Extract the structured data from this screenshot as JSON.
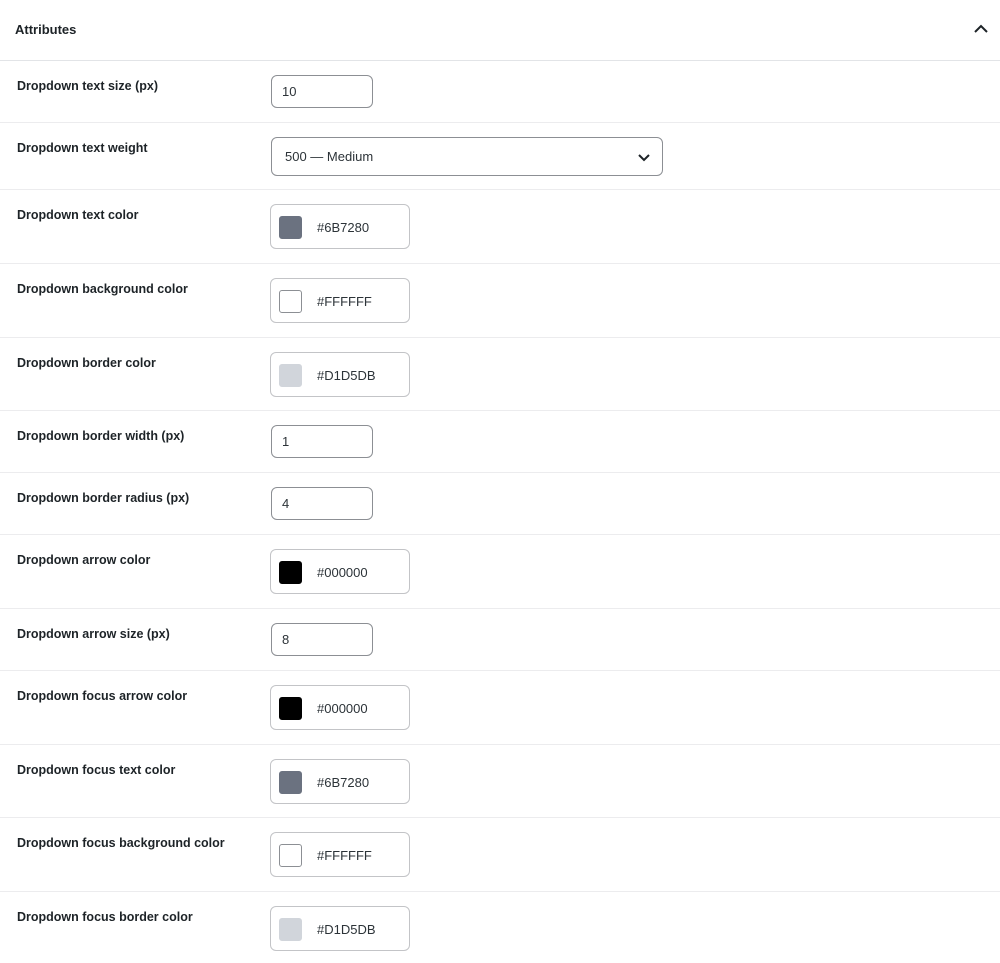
{
  "panel": {
    "title": "Attributes",
    "toggle_icon": "chevron-up-icon"
  },
  "fields": {
    "text_size": {
      "label": "Dropdown text size (px)",
      "value": "10"
    },
    "text_weight": {
      "label": "Dropdown text weight",
      "value": "500 — Medium",
      "icon": "chevron-down-icon"
    },
    "text_color": {
      "label": "Dropdown text color",
      "hex": "#6B7280",
      "swatch": "#6B7280"
    },
    "bg_color": {
      "label": "Dropdown background color",
      "hex": "#FFFFFF",
      "swatch": "#FFFFFF"
    },
    "border_color": {
      "label": "Dropdown border color",
      "hex": "#D1D5DB",
      "swatch": "#D1D5DB"
    },
    "border_width": {
      "label": "Dropdown border width (px)",
      "value": "1"
    },
    "border_radius": {
      "label": "Dropdown border radius (px)",
      "value": "4"
    },
    "arrow_color": {
      "label": "Dropdown arrow color",
      "hex": "#000000",
      "swatch": "#000000"
    },
    "arrow_size": {
      "label": "Dropdown arrow size (px)",
      "value": "8"
    },
    "focus_arrow_color": {
      "label": "Dropdown focus arrow color",
      "hex": "#000000",
      "swatch": "#000000"
    },
    "focus_text_color": {
      "label": "Dropdown focus text color",
      "hex": "#6B7280",
      "swatch": "#6B7280"
    },
    "focus_bg_color": {
      "label": "Dropdown focus background color",
      "hex": "#FFFFFF",
      "swatch": "#FFFFFF"
    },
    "focus_border_color": {
      "label": "Dropdown focus border color",
      "hex": "#D1D5DB",
      "swatch": "#D1D5DB"
    }
  }
}
